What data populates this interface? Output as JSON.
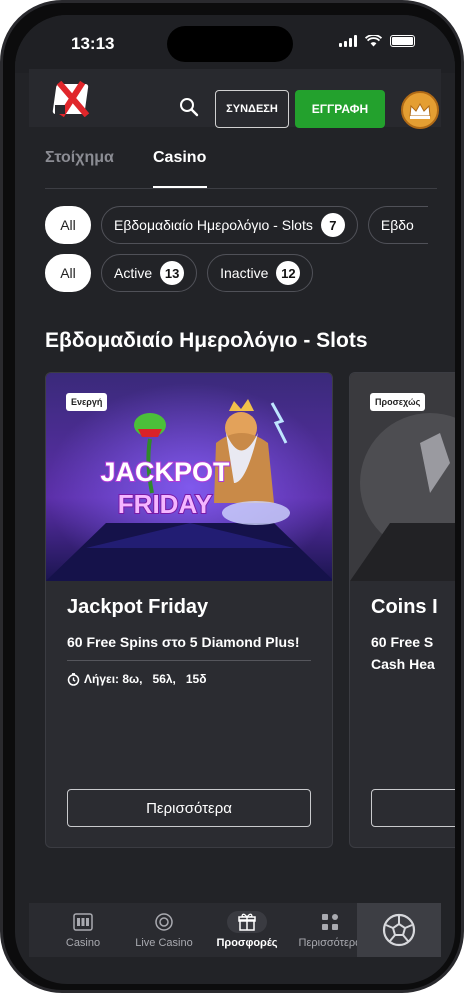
{
  "status": {
    "time": "13:13"
  },
  "header": {
    "login_label": "ΣΥΝΔΕΣΗ",
    "register_label": "ΕΓΓΡΑΦΗ",
    "colors": {
      "register": "#23a12d",
      "logo_red": "#e0262b"
    }
  },
  "tabs": [
    {
      "label": "Στοίχημα",
      "active": false
    },
    {
      "label": "Casino",
      "active": true
    }
  ],
  "category_filters": [
    {
      "label": "All",
      "selected": true
    },
    {
      "label": "Εβδομαδιαίο Ημερολόγιο - Slots",
      "count": "7"
    },
    {
      "label": "Εβδο"
    }
  ],
  "status_filters": [
    {
      "label": "All",
      "selected": true
    },
    {
      "label": "Active",
      "count": "13"
    },
    {
      "label": "Inactive",
      "count": "12"
    }
  ],
  "section": {
    "title": "Εβδομαδιαίο Ημερολόγιο - Slots"
  },
  "cards": [
    {
      "badge": "Ενεργή",
      "banner_text_1": "JACKPOT",
      "banner_text_2": "FRIDAY",
      "title": "Jackpot Friday",
      "description": "60 Free Spins στο 5 Diamond Plus!",
      "expires": "Λήγει: 8ω,   56λ,   15δ",
      "button": "Περισσότερα"
    },
    {
      "badge": "Προσεχώς",
      "title": "Coins I",
      "description_1": "60 Free S",
      "description_2": "Cash Hea"
    }
  ],
  "bottom_nav": [
    {
      "label": "Casino",
      "icon": "slot-machine-icon"
    },
    {
      "label": "Live Casino",
      "icon": "chip-icon"
    },
    {
      "label": "Προσφορές",
      "icon": "gift-icon",
      "active": true
    },
    {
      "label": "Περισσότερα",
      "icon": "grid-icon"
    }
  ]
}
